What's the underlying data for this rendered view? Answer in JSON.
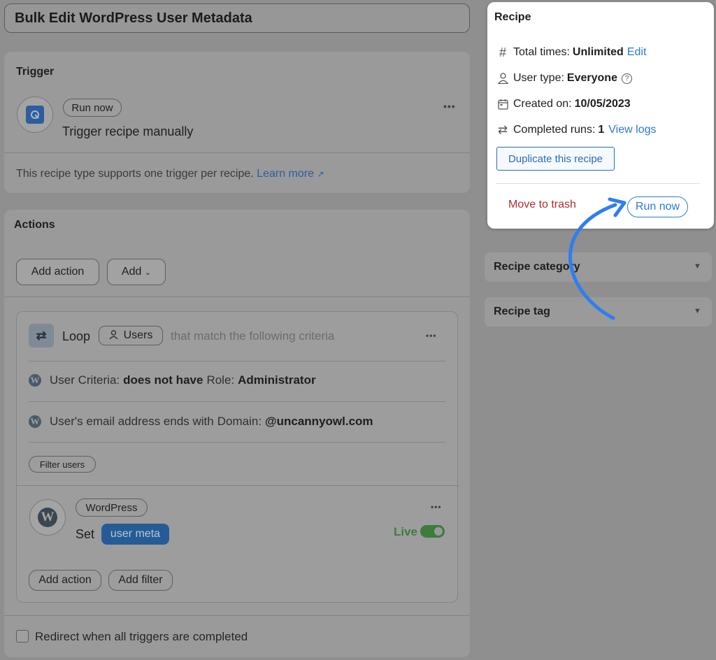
{
  "title": "Bulk Edit WordPress User Metadata",
  "trigger": {
    "heading": "Trigger",
    "badge": "Run now",
    "label": "Trigger recipe manually",
    "note": "This recipe type supports one trigger per recipe.",
    "learn_more": "Learn more"
  },
  "actions": {
    "heading": "Actions",
    "add_action": "Add action",
    "add": "Add",
    "loop": {
      "label": "Loop",
      "users_pill": "Users",
      "criteria_text": "that match the following criteria",
      "filter1": {
        "prefix": "User Criteria:",
        "value1": "does not have",
        "mid": "Role:",
        "value2": "Administrator"
      },
      "filter2": {
        "prefix": "User's email address ends with",
        "mid": "Domain:",
        "value": "@uncannyowl.com"
      },
      "filter_users": "Filter users",
      "action": {
        "integration": "WordPress",
        "set": "Set",
        "token": "user meta",
        "live": "Live"
      },
      "add_action": "Add action",
      "add_filter": "Add filter"
    }
  },
  "redirect_label": "Redirect when all triggers are completed",
  "recipe_panel": {
    "heading": "Recipe",
    "total_times_label": "Total times:",
    "total_times_value": "Unlimited",
    "edit": "Edit",
    "user_type_label": "User type:",
    "user_type_value": "Everyone",
    "created_label": "Created on:",
    "created_value": "10/05/2023",
    "runs_label": "Completed runs:",
    "runs_value": "1",
    "view_logs": "View logs",
    "duplicate": "Duplicate this recipe",
    "trash": "Move to trash",
    "run_now": "Run now"
  },
  "category": {
    "label": "Recipe category"
  },
  "tag": {
    "label": "Recipe tag"
  },
  "colors": {
    "accent": "#2c7ad6",
    "danger": "#b32d2e",
    "live": "#3f7a3f",
    "arrow": "#2f7ef0"
  }
}
